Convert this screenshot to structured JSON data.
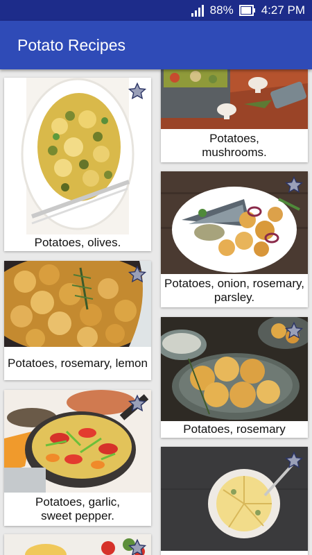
{
  "status": {
    "battery": "88%",
    "time": "4:27 PM"
  },
  "app": {
    "title": "Potato Recipes"
  },
  "recipes": [
    {
      "caption": "Potatoes, olives."
    },
    {
      "caption": "Potatoes, mushrooms."
    },
    {
      "caption": "Potatoes, onion, rosemary, parsley."
    },
    {
      "caption": "Potatoes, rosemary, lemon"
    },
    {
      "caption": "Potatoes, rosemary"
    },
    {
      "caption": "Potatoes, garlic, sweet pepper."
    },
    {
      "caption": ""
    },
    {
      "caption": ""
    }
  ],
  "colors": {
    "status_bar": "#1d2c8a",
    "app_bar": "#2f4bb7",
    "star_fill": "#9aa0b8",
    "star_stroke": "#2c3566"
  },
  "icons": {
    "signal": "signal-icon",
    "battery": "battery-icon",
    "favorite": "star-icon"
  }
}
